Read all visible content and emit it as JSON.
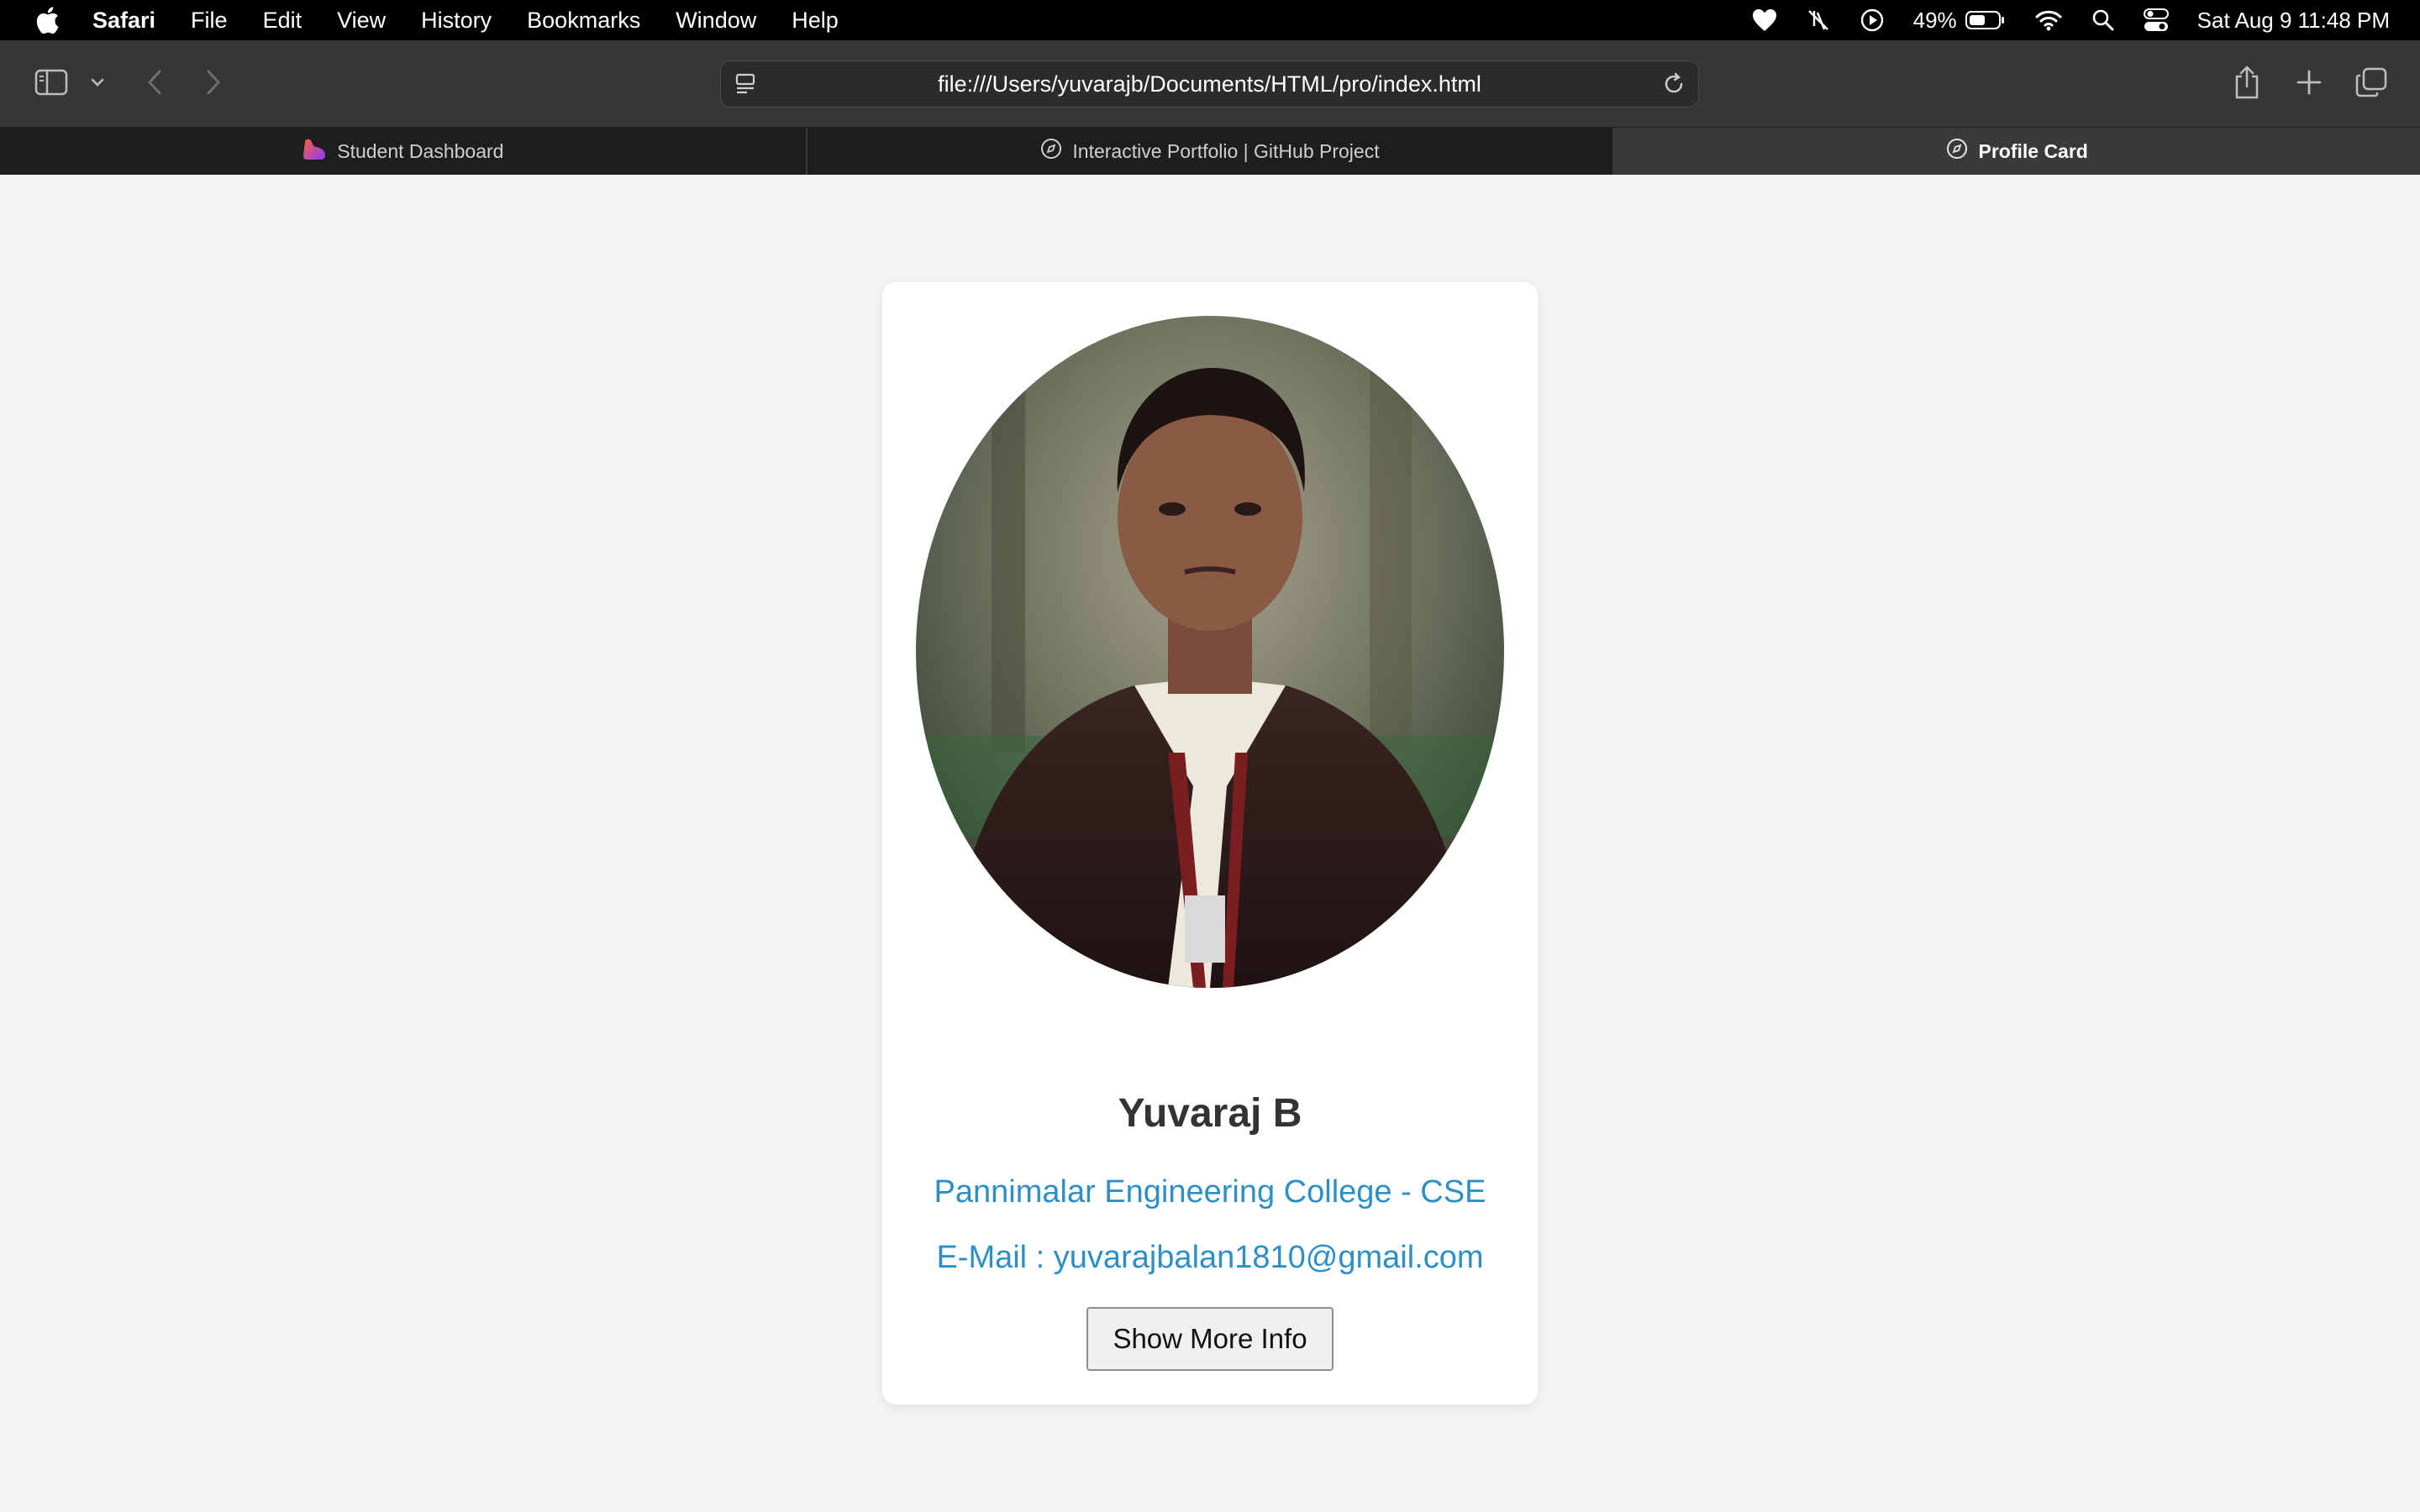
{
  "menubar": {
    "app_name": "Safari",
    "items": [
      "File",
      "Edit",
      "View",
      "History",
      "Bookmarks",
      "Window",
      "Help"
    ],
    "battery": "49%",
    "datetime": "Sat Aug 9  11:48 PM"
  },
  "toolbar": {
    "url": "file:///Users/yuvarajb/Documents/HTML/pro/index.html"
  },
  "tabs": [
    {
      "label": "Student Dashboard",
      "icon": "heart-favicon",
      "active": false
    },
    {
      "label": "Interactive Portfolio | GitHub Project",
      "icon": "compass-icon",
      "active": false
    },
    {
      "label": "Profile Card",
      "icon": "compass-icon",
      "active": true
    }
  ],
  "profile": {
    "name": "Yuvaraj B",
    "college": "Pannimalar Engineering College - CSE",
    "email": "E-Mail : yuvarajbalan1810@gmail.com",
    "button_label": "Show More Info"
  },
  "colors": {
    "link_blue": "#2e8fc6",
    "page_bg": "#f4f4f4"
  }
}
